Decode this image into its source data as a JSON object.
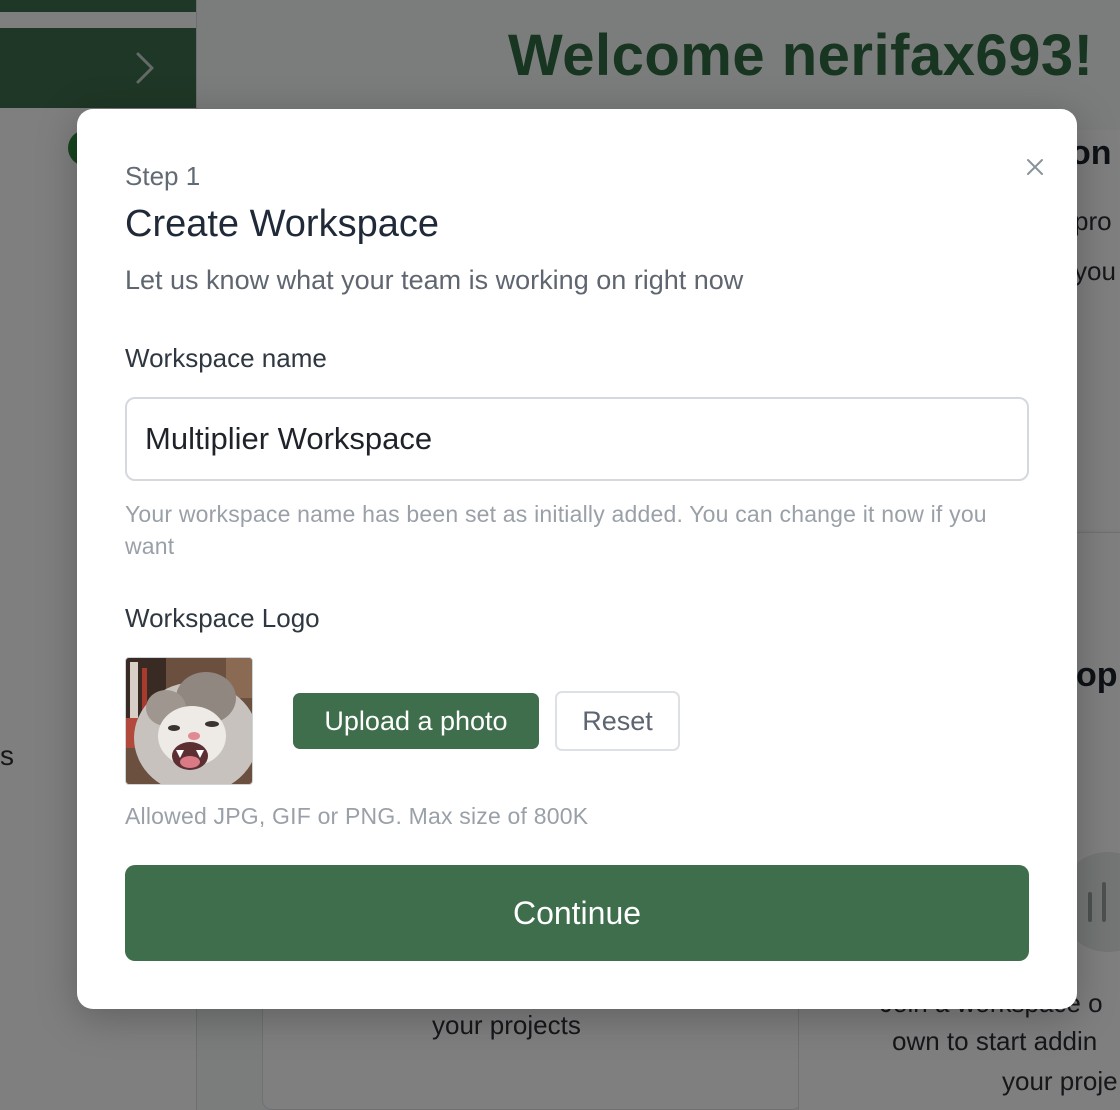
{
  "background": {
    "welcome_heading": "Welcome nerifax693!",
    "sidebar_fragment": "s",
    "panel_heading_fragment": "on",
    "panel_text_fragment_1": "pro",
    "panel_text_fragment_2": "you",
    "card_heading_fragment": "op",
    "card1_text": "your projects",
    "card2_text_line1": "Join a workspace o",
    "card2_text_line2": "own to start addin",
    "card2_text_line3": "your proje"
  },
  "modal": {
    "step": "Step 1",
    "title": "Create Workspace",
    "subtitle": "Let us know what your team is working on right now",
    "workspace_name_label": "Workspace name",
    "workspace_name_value": "Multiplier Workspace",
    "workspace_name_help": "Your workspace name has been set as initially added. You can change it now if you want",
    "logo_label": "Workspace Logo",
    "upload_button": "Upload a photo",
    "reset_button": "Reset",
    "allowed_text": "Allowed JPG, GIF or PNG. Max size of 800K",
    "continue_button": "Continue"
  },
  "colors": {
    "brand_green": "#3e6e4c",
    "heading_green": "#2e6b40"
  },
  "icons": {
    "close": "close-icon",
    "sidebar_toggle": "chevron-right-icon",
    "chart": "bar-chart-icon"
  }
}
